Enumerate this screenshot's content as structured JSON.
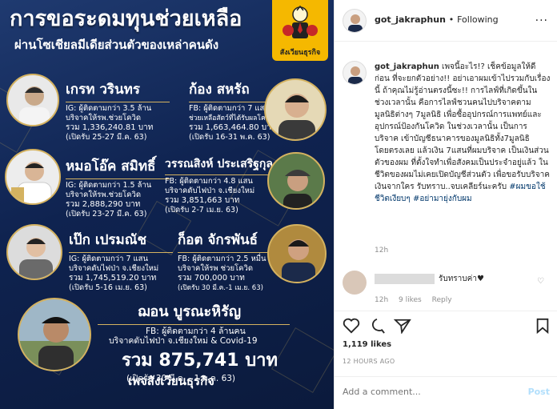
{
  "poster": {
    "title": "การขอระดมทุนช่วยเหลือ",
    "subtitle": "ผ่านโซเชียลมีเดียส่วนตัวของเหล่าคนดัง",
    "logo_text": "สังเวียนธุรกิจ",
    "footer": "เพจสังเวียนธุรกิจ",
    "accent_gold": "#d4b260",
    "bg_navy": "#0f2350",
    "logo_yellow": "#f5b800",
    "people": [
      {
        "name": "เกรท วรินทร",
        "info1": "IG: ผู้ติดตามกว่า 3.5 ล้าน",
        "info2": "บริจาคให้รพ.ช่วยโควิด",
        "amount": "รวม 1,336,240.81 บาท",
        "period": "(เปิดรับ 25-27 มี.ค. 63)"
      },
      {
        "name": "ก้อง สหรัถ",
        "info1": "FB: ผู้ติดตามกว่า 7 แสน",
        "info2": "ช่วยเหลือสัตว์ที่ได้รับผลโควิด",
        "amount": "รวม 1,663,464.80 บาท",
        "period": "(เปิดรับ 16-31 พ.ค. 63)"
      },
      {
        "name": "หมอโอ๊ค สมิทธิ์",
        "info1": "IG: ผู้ติดตามกว่า 1.5 ล้าน",
        "info2": "บริจาคให้รพ.ช่วยโควิด",
        "amount": "รวม 2,888,290 บาท",
        "period": "(เปิดรับ 23-27 มี.ค. 63)"
      },
      {
        "name": "วรรณสิงห์ ประเสริฐกุล",
        "info1": "FB: ผู้ติดตามกว่า 4.8 แสน",
        "info2": "บริจาคดับไฟป่า จ.เชียงใหม่",
        "amount": "รวม 3,851,663 บาท",
        "period": "(เปิดรับ 2-7 เม.ย. 63)"
      },
      {
        "name": "เป๊ก เปรมณัช",
        "info1": "IG: ผู้ติดตามกว่า 7 แสน",
        "info2": "บริจาคดับไฟป่า จ.เชียงใหม่",
        "amount": "รวม 1,745,519.20 บาท",
        "period": "(เปิดรับ 5-16 เม.ย. 63)"
      },
      {
        "name": "ก็อต จักรพันธ์",
        "info1": "FB: ผู้ติดตามกว่า 2.5 หมื่น",
        "info2": "บริจาคให้รพ ช่วยโควิด",
        "amount": "รวม 700,000 บาท",
        "period": "(เปิดรับ 30 มี.ค.-1 เม.ย. 63)"
      }
    ],
    "featured": {
      "name": "ฌอน บูรณะหิรัญ",
      "info1": "FB: ผู้ติดตามกว่า 4 ล้านคน",
      "info2": "บริจาคดับไฟป่า จ.เชียงใหม่ & Covid-19",
      "amount": "รวม 875,741 บาท",
      "period": "(เปิดรับ 30 มี.ค. - 1 พ.ค. 63)"
    }
  },
  "header": {
    "username": "got_jakraphun",
    "separator": "•",
    "follow_status": "Following",
    "more": "..."
  },
  "caption": {
    "username": "got_jakraphun",
    "text": " เพจนี้อะไร!? เช็คข้อมูลให้ดีก่อน ที่จะยกตัวอย่าง!! อย่าเอาผมเข้าไปรวมกับเรื่องนี้ ถ้าคุณไม่รู้อ่านตรงนี้ซะ!! การไลฟ์ที่เกิดขึ้นในช่วงเวลานั้น คือการไลฟ์ชวนคนไปบริจาคตามมูลนิธิต่างๆ 7มูลนิธิ เพื่อซื้ออุปกรณ์การแพทย์และอุปกรณ์ป้องกันโควิด ในช่วงเวลานั้น เป็นการบริจาค เข้าบัญชีธนาคารของมูลนิธิทั้ง7มูลนิธิโดยตรงเลย แล้วเงิน 7แสนที่ผมบริจาค เป็นเงินส่วนตัวของผม ที่ตั้งใจทำเพื่อสังคมเป็นประจำอยู่แล้ว ในชีวิตของผมไม่เคยเปิดบัญชีส่วนตัว เพื่อขอรับบริจาคเงินจากใคร รับทราบ..จบเคลียร์นะครับ ",
    "tags": "#ผมขอใช้ชีวิตเงียบๆ #อย่ามายุ่งกับผม",
    "time": "12h"
  },
  "reply": {
    "text": "รับทราบค่า♥",
    "time": "12h",
    "likes": "9 likes",
    "reply_label": "Reply"
  },
  "stats": {
    "likes": "1,119 likes",
    "ago": "12 HOURS AGO"
  },
  "comment_box": {
    "placeholder": "Add a comment...",
    "post_label": "Post"
  }
}
